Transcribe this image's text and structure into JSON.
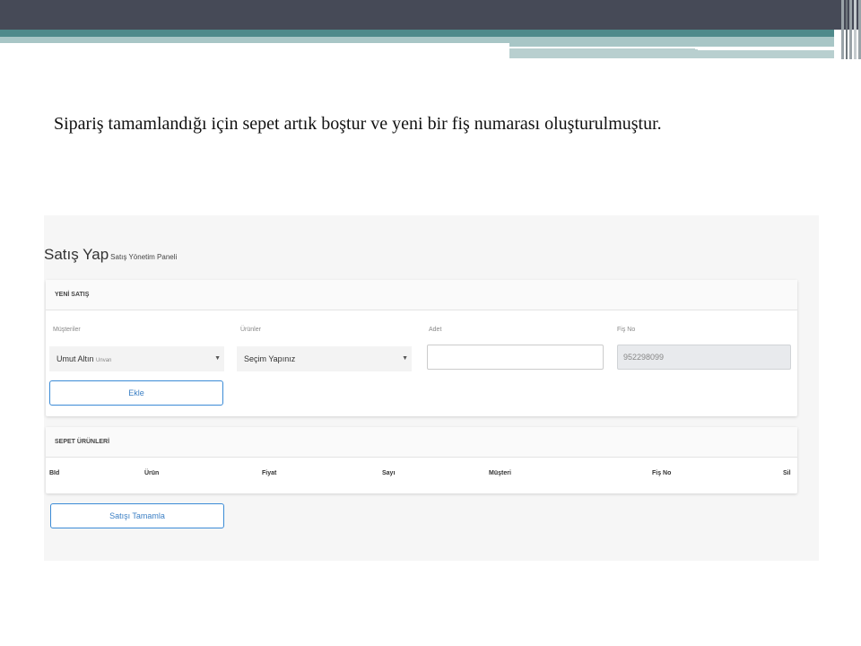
{
  "caption": "Sipariş tamamlandığı için sepet artık boştur ve yeni bir fiş numarası oluşturulmuştur.",
  "app": {
    "title": "Satış Yap",
    "subtitle": "Satış Yönetim Paneli",
    "new_sale": {
      "header": "YENİ SATIŞ",
      "customers_label": "Müşteriler",
      "customer_value": "Umut Altın",
      "customer_hint": "Unvan",
      "products_label": "Ürünler",
      "product_value": "Seçim Yapınız",
      "quantity_label": "Adet",
      "quantity_value": "",
      "receipt_label": "Fiş No",
      "receipt_value": "952298099",
      "add_button": "Ekle"
    },
    "basket": {
      "header": "SEPET ÜRÜNLERİ",
      "columns": [
        "BId",
        "Ürün",
        "Fiyat",
        "Sayı",
        "Müşteri",
        "Fiş No",
        "Sil"
      ]
    },
    "complete_button": "Satışı Tamamla"
  },
  "icons": {
    "caret": "caret-down-icon"
  },
  "colors": {
    "accent": "#3b8bd6",
    "header_bar": "#464a57",
    "teal": "#4f8a8b"
  }
}
